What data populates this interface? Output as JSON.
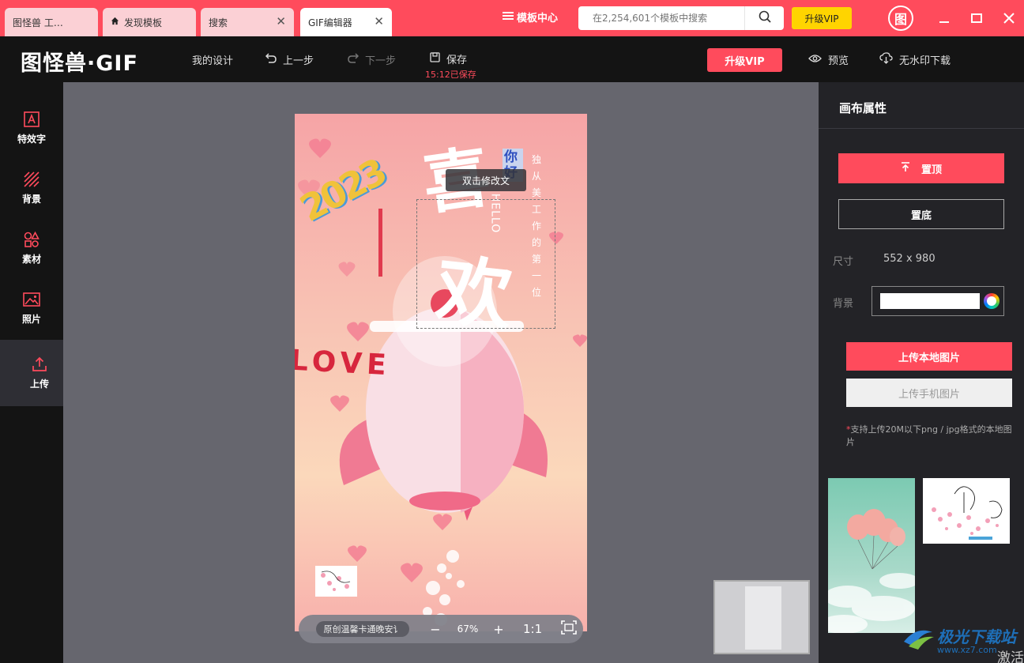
{
  "tabs": [
    {
      "label": "图怪兽  工…",
      "icon": "",
      "closable": false,
      "active": false
    },
    {
      "label": "发现模板",
      "icon": "home-icon",
      "closable": false,
      "active": false
    },
    {
      "label": "搜索",
      "icon": "",
      "closable": true,
      "active": false
    },
    {
      "label": "GIF编辑器",
      "icon": "",
      "closable": true,
      "active": true
    }
  ],
  "titlebar": {
    "template_center": "模板中心",
    "search_placeholder": "在2,254,601个模板中搜索",
    "upgrade_vip": "升级VIP",
    "logo_text": "图"
  },
  "toolbar": {
    "brand": "图怪兽·GIF",
    "my_designs": "我的设计",
    "undo": "上一步",
    "redo": "下一步",
    "save": "保存",
    "saved_time": "15:12已保存",
    "upgrade_vip": "升级VIP",
    "preview": "预览",
    "download": "无水印下载"
  },
  "sidebar": {
    "items": [
      {
        "label": "特效字",
        "icon": "text-effect-icon"
      },
      {
        "label": "背景",
        "icon": "background-icon"
      },
      {
        "label": "素材",
        "icon": "shapes-icon"
      },
      {
        "label": "照片",
        "icon": "photo-icon"
      },
      {
        "label": "上传",
        "icon": "upload-icon"
      }
    ]
  },
  "canvas": {
    "hint": "双击修改文",
    "poster_text": {
      "big1": "喜",
      "big2": "欢",
      "year": "2023",
      "nihao": "你好",
      "hello": "HELLO",
      "vertical": "独 从 美 工 作 的 第 一 位",
      "love": "LOVE"
    },
    "layer_name": "原创温馨卡通晚安讠",
    "zoom": "67%",
    "one_to_one": "1:1"
  },
  "panel": {
    "title": "画布属性",
    "bring_to_top": "置顶",
    "send_to_bottom": "置底",
    "size_label": "尺寸",
    "size_value": "552 x 980",
    "bg_label": "背景",
    "bg_color": "#ffffff",
    "upload_local": "上传本地图片",
    "upload_phone": "上传手机图片",
    "upload_note_mark": "*",
    "upload_note": "支持上传20M以下png / jpg格式的本地图片"
  },
  "watermark": {
    "brand": "极光下载站",
    "url": "www.xz7.com",
    "activate": "激活"
  },
  "colors": {
    "accent": "#ff4b5c",
    "vip_yellow": "#ffd400",
    "dark": "#141414",
    "workspace": "#66666e"
  }
}
